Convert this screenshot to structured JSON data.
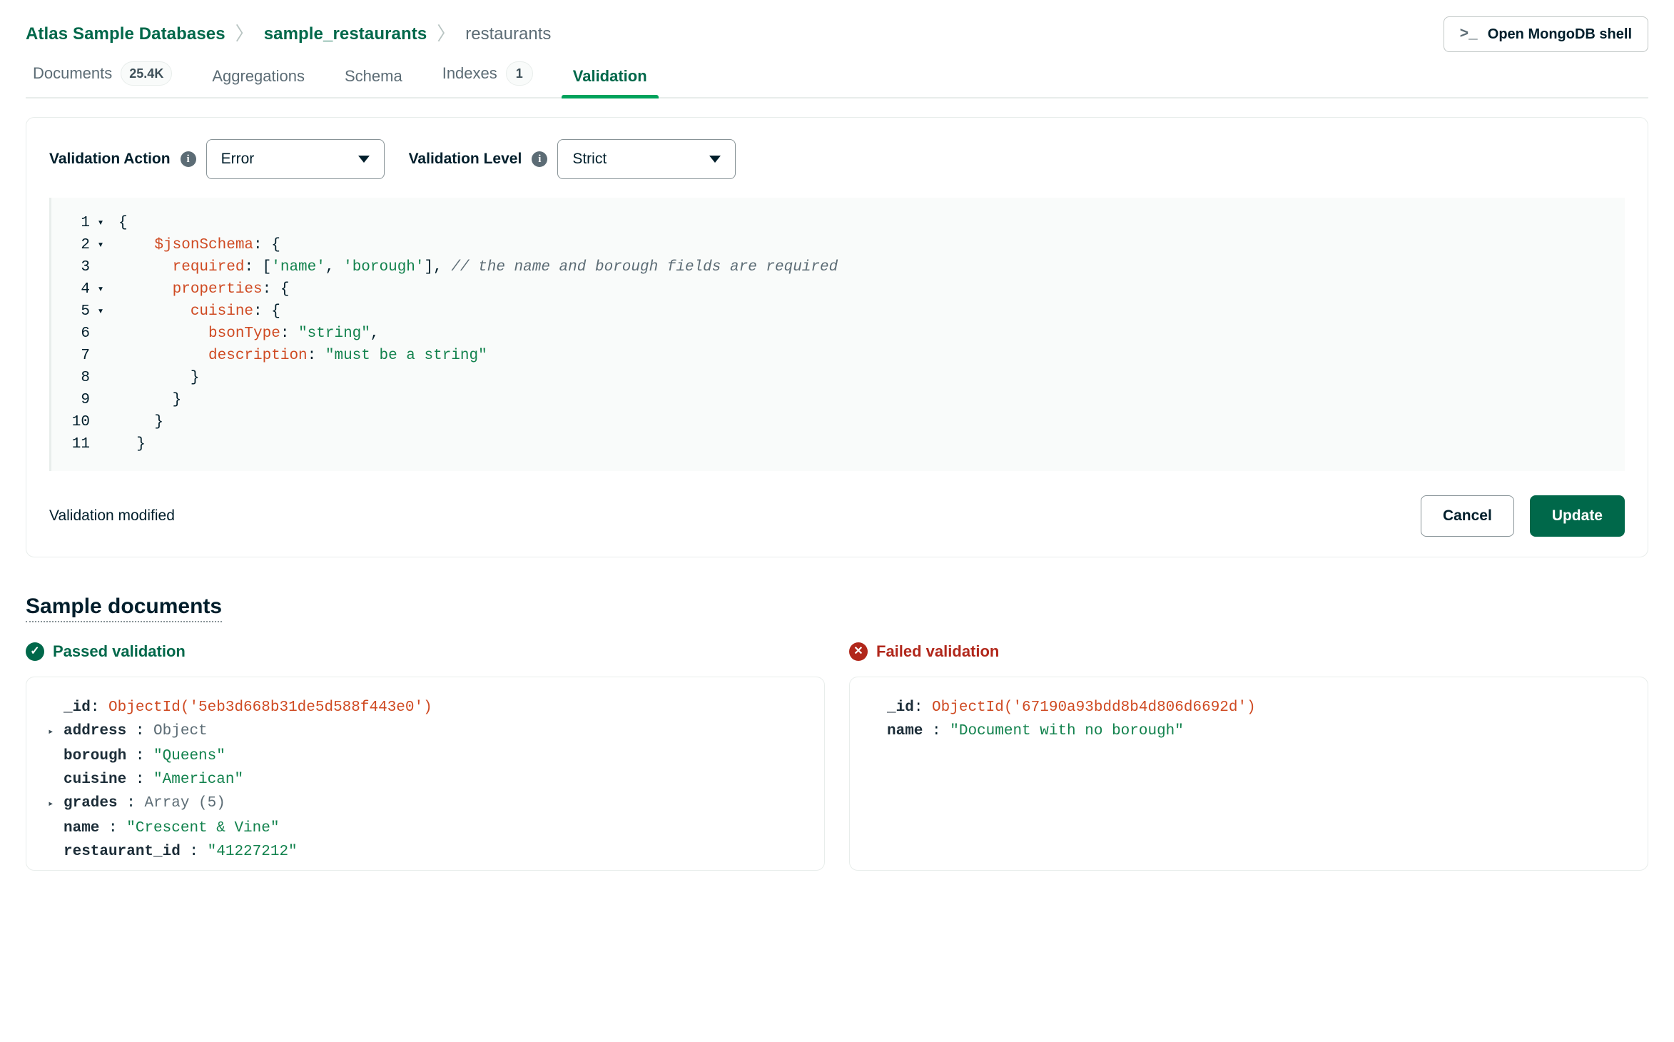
{
  "breadcrumb": {
    "items": [
      "Atlas Sample Databases",
      "sample_restaurants",
      "restaurants"
    ],
    "separator": "〉"
  },
  "header": {
    "shell_button_label": "Open MongoDB shell",
    "shell_icon": "terminal-prompt-icon",
    "shell_icon_glyph": ">_"
  },
  "tabs": [
    {
      "label": "Documents",
      "badge": "25.4K",
      "active": false
    },
    {
      "label": "Aggregations",
      "badge": "",
      "active": false
    },
    {
      "label": "Schema",
      "badge": "",
      "active": false
    },
    {
      "label": "Indexes",
      "badge": "1",
      "active": false
    },
    {
      "label": "Validation",
      "badge": "",
      "active": true
    }
  ],
  "validation": {
    "action_label": "Validation Action",
    "action_value": "Error",
    "level_label": "Validation Level",
    "level_value": "Strict",
    "info_glyph": "i",
    "status_text": "Validation modified",
    "cancel_label": "Cancel",
    "update_label": "Update",
    "code_lines": [
      {
        "n": "1",
        "fold": "▾",
        "segments": [
          {
            "t": "pun",
            "v": "{"
          }
        ]
      },
      {
        "n": "2",
        "fold": "▾",
        "segments": [
          {
            "t": "key",
            "v": "    $jsonSchema"
          },
          {
            "t": "pun",
            "v": ": {"
          }
        ]
      },
      {
        "n": "3",
        "fold": "",
        "segments": [
          {
            "t": "key",
            "v": "      required"
          },
          {
            "t": "pun",
            "v": ": ["
          },
          {
            "t": "str",
            "v": "'name'"
          },
          {
            "t": "pun",
            "v": ", "
          },
          {
            "t": "str",
            "v": "'borough'"
          },
          {
            "t": "pun",
            "v": "], "
          },
          {
            "t": "com",
            "v": "// the name and borough fields are required"
          }
        ]
      },
      {
        "n": "4",
        "fold": "▾",
        "segments": [
          {
            "t": "key",
            "v": "      properties"
          },
          {
            "t": "pun",
            "v": ": {"
          }
        ]
      },
      {
        "n": "5",
        "fold": "▾",
        "segments": [
          {
            "t": "key",
            "v": "        cuisine"
          },
          {
            "t": "pun",
            "v": ": {"
          }
        ]
      },
      {
        "n": "6",
        "fold": "",
        "segments": [
          {
            "t": "key",
            "v": "          bsonType"
          },
          {
            "t": "pun",
            "v": ": "
          },
          {
            "t": "str",
            "v": "\"string\""
          },
          {
            "t": "pun",
            "v": ","
          }
        ]
      },
      {
        "n": "7",
        "fold": "",
        "segments": [
          {
            "t": "key",
            "v": "          description"
          },
          {
            "t": "pun",
            "v": ": "
          },
          {
            "t": "str",
            "v": "\"must be a string\""
          }
        ]
      },
      {
        "n": "8",
        "fold": "",
        "segments": [
          {
            "t": "pun",
            "v": "        }"
          }
        ]
      },
      {
        "n": "9",
        "fold": "",
        "segments": [
          {
            "t": "pun",
            "v": "      }"
          }
        ]
      },
      {
        "n": "10",
        "fold": "",
        "segments": [
          {
            "t": "pun",
            "v": "    }"
          }
        ]
      },
      {
        "n": "11",
        "fold": "",
        "segments": [
          {
            "t": "pun",
            "v": "  }"
          }
        ]
      }
    ]
  },
  "samples": {
    "title": "Sample documents",
    "passed": {
      "status_label": "Passed validation",
      "status_icon": "check-circle-icon",
      "status_glyph": "✓",
      "fields": [
        {
          "arrow": "",
          "key": "_id",
          "sep": ": ",
          "value": "ObjectId('5eb3d668b31de5d588f443e0')",
          "vtype": "oid"
        },
        {
          "arrow": "▸",
          "key": "address",
          "sep": " : ",
          "value": "Object",
          "vtype": "meta"
        },
        {
          "arrow": "",
          "key": "borough",
          "sep": " : ",
          "value": "\"Queens\"",
          "vtype": "str"
        },
        {
          "arrow": "",
          "key": "cuisine",
          "sep": " : ",
          "value": "\"American\"",
          "vtype": "str"
        },
        {
          "arrow": "▸",
          "key": "grades",
          "sep": " : ",
          "value": "Array (5)",
          "vtype": "meta"
        },
        {
          "arrow": "",
          "key": "name",
          "sep": " : ",
          "value": "\"Crescent & Vine\"",
          "vtype": "str"
        },
        {
          "arrow": "",
          "key": "restaurant_id",
          "sep": " : ",
          "value": "\"41227212\"",
          "vtype": "str"
        }
      ]
    },
    "failed": {
      "status_label": "Failed validation",
      "status_icon": "x-circle-icon",
      "status_glyph": "✕",
      "fields": [
        {
          "arrow": "",
          "key": "_id",
          "sep": ": ",
          "value": "ObjectId('67190a93bdd8b4d806d6692d')",
          "vtype": "oid"
        },
        {
          "arrow": "",
          "key": "name",
          "sep": " : ",
          "value": "\"Document with no borough\"",
          "vtype": "str"
        }
      ]
    }
  },
  "colors": {
    "brand_green": "#00684A",
    "accent_green": "#00A35C",
    "error_red": "#B1271B",
    "code_key": "#CF4A22",
    "code_string": "#12824D",
    "code_comment": "#5C6C75"
  }
}
